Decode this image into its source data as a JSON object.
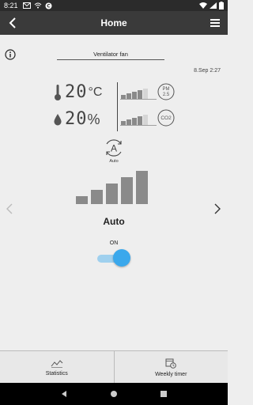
{
  "status_bar": {
    "time": "8:21"
  },
  "app_bar": {
    "title": "Home"
  },
  "device": {
    "name": "Ventilator fan",
    "timestamp": "8.Sep 2:27"
  },
  "sensors": {
    "temperature": {
      "value": "20",
      "unit": "°C"
    },
    "humidity": {
      "value": "20",
      "unit": "%"
    },
    "pm_badge": {
      "line1": "PM",
      "line2": "2.5"
    },
    "co2_badge": "CO2",
    "pm_level": 4,
    "co2_level": 4
  },
  "mode": {
    "icon_letter": "A",
    "label": "Auto"
  },
  "fan": {
    "speed_label": "Auto",
    "level": 5
  },
  "power": {
    "label": "ON",
    "on": true
  },
  "tabs": [
    {
      "label": "Statistics"
    },
    {
      "label": "Weekly timer"
    }
  ],
  "colors": {
    "accent": "#3aa8ec",
    "appbar": "#3a3a3a",
    "bars": "#8a8a8a"
  }
}
